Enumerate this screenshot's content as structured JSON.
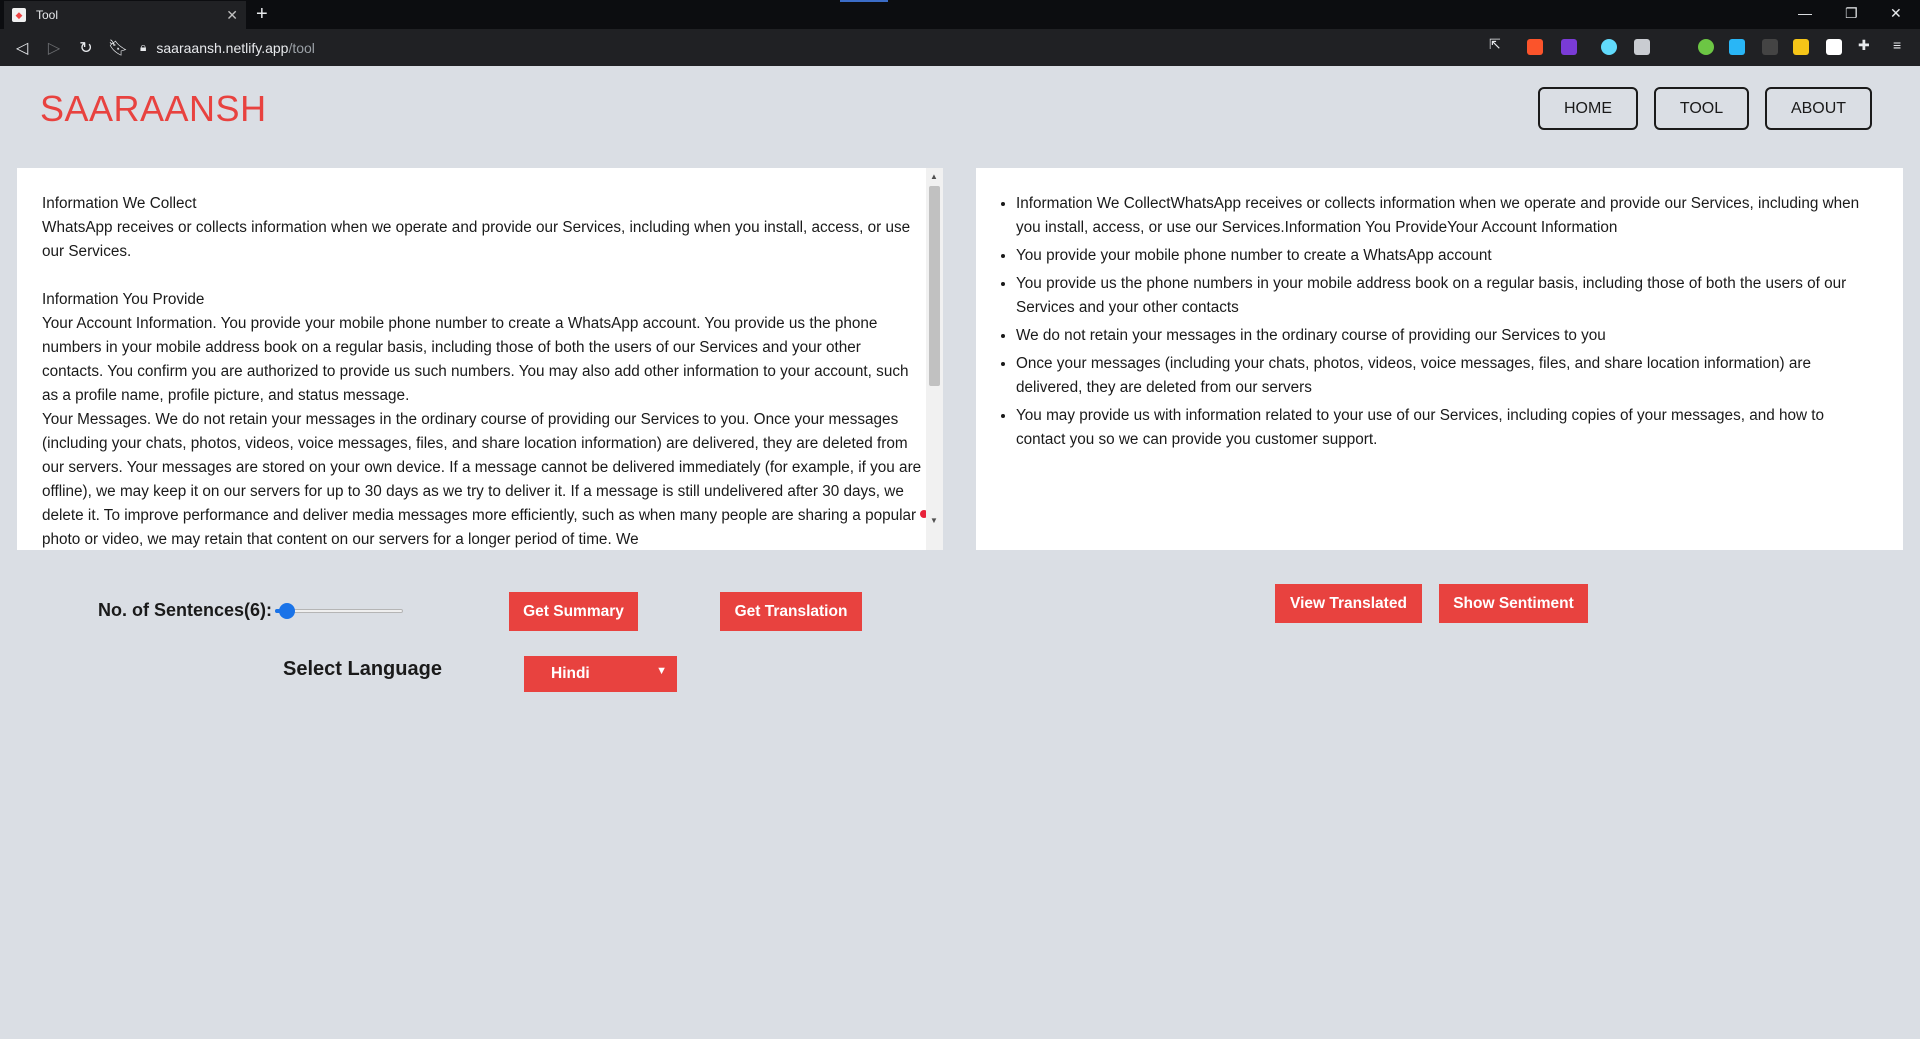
{
  "browser": {
    "tab_title": "Tool",
    "url_domain": "saaraansh.netlify.app",
    "url_path": "/tool",
    "new_tab": "+",
    "close": "✕"
  },
  "site": {
    "logo": "SAARAANSH",
    "nav": [
      {
        "label": "HOME"
      },
      {
        "label": "TOOL"
      },
      {
        "label": "ABOUT"
      }
    ]
  },
  "input_text": "Information We Collect\nWhatsApp receives or collects information when we operate and provide our Services, including when you install, access, or use our Services.\n\nInformation You Provide\nYour Account Information. You provide your mobile phone number to create a WhatsApp account. You provide us the phone numbers in your mobile address book on a regular basis, including those of both the users of our Services and your other contacts. You confirm you are authorized to provide us such numbers. You may also add other information to your account, such as a profile name, profile picture, and status message.\nYour Messages. We do not retain your messages in the ordinary course of providing our Services to you. Once your messages (including your chats, photos, videos, voice messages, files, and share location information) are delivered, they are deleted from our servers. Your messages are stored on your own device. If a message cannot be delivered immediately (for example, if you are offline), we may keep it on our servers for up to 30 days as we try to deliver it. If a message is still undelivered after 30 days, we delete it. To improve performance and deliver media messages more efficiently, such as when many people are sharing a popular photo or video, we may retain that content on our servers for a longer period of time. We",
  "summary": [
    "Information We CollectWhatsApp receives or collects information when we operate and provide our Services, including when you install, access, or use our Services.Information You ProvideYour Account Information",
    "You provide your mobile phone number to create a WhatsApp account",
    "You provide us the phone numbers in your mobile address book on a regular basis, including those of both the users of our Services and your other contacts",
    "We do not retain your messages in the ordinary course of providing our Services to you",
    "Once your messages (including your chats, photos, videos, voice messages, files, and share location information) are delivered, they are deleted from our servers",
    "You may provide us with information related to your use of our Services, including copies of your messages, and how to contact you so we can provide you customer support."
  ],
  "controls": {
    "sentences_label": "No. of Sentences(6):",
    "sentences_value": 6,
    "get_summary": "Get Summary",
    "get_translation": "Get Translation",
    "view_translated": "View Translated",
    "show_sentiment": "Show Sentiment",
    "language_label": "Select Language",
    "language_value": "Hindi"
  }
}
